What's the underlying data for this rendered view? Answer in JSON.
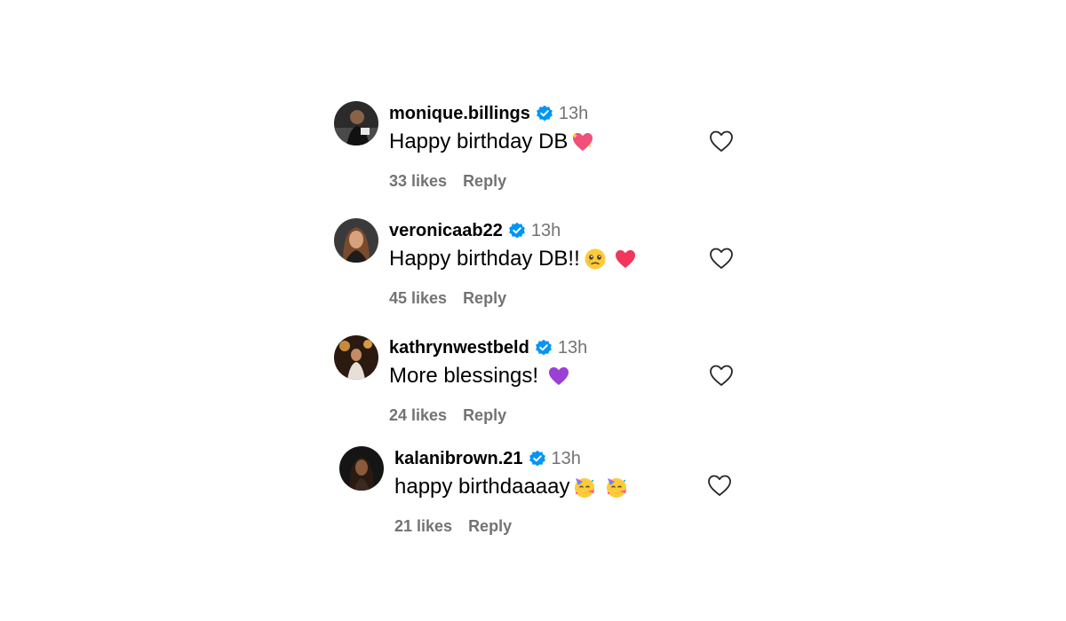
{
  "colors": {
    "username": "#000000",
    "muted": "#737373",
    "verified_badge": "#0095f6",
    "heart_outline": "#262626"
  },
  "comments": [
    {
      "username": "monique.billings",
      "verified": true,
      "timestamp": "13h",
      "text": "Happy birthday DB",
      "emojis": [
        "sparkling-heart-emoji"
      ],
      "likes": "33 likes",
      "reply": "Reply"
    },
    {
      "username": "veronicaab22",
      "verified": true,
      "timestamp": "13h",
      "text": "Happy birthday DB!!",
      "emojis": [
        "face-holding-back-tears-emoji",
        "red-heart-emoji"
      ],
      "likes": "45 likes",
      "reply": "Reply"
    },
    {
      "username": "kathrynwestbeld",
      "verified": true,
      "timestamp": "13h",
      "text": "More blessings!",
      "emojis": [
        "purple-heart-emoji"
      ],
      "likes": "24 likes",
      "reply": "Reply"
    },
    {
      "username": "kalanibrown.21",
      "verified": true,
      "timestamp": "13h",
      "text": "happy birthdaaaay",
      "emojis": [
        "partying-face-emoji",
        "partying-face-emoji"
      ],
      "likes": "21 likes",
      "reply": "Reply"
    }
  ]
}
